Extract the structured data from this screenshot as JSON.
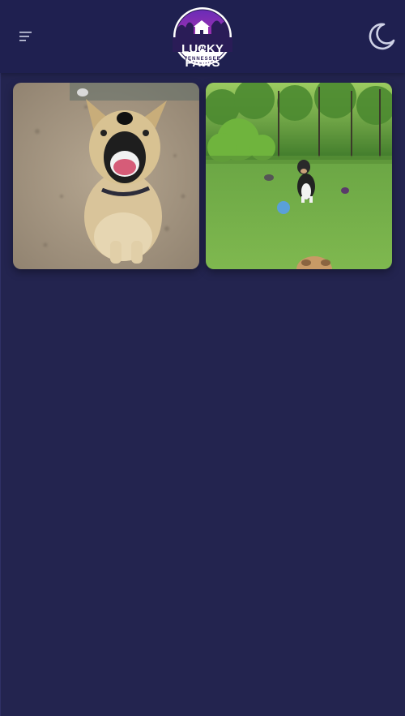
{
  "header": {
    "logo": {
      "title": "LUCKY PAWS",
      "subtitle": "TENNESSEE"
    },
    "menu_icon": "hamburger-menu-icon",
    "theme_icon": "moon-icon"
  },
  "gallery": {
    "photos": [
      {
        "subject": "smiling-dog-photo"
      },
      {
        "subject": "dog-in-field-photo"
      }
    ]
  },
  "colors": {
    "page_bg": "#23244f",
    "header_bg": "#1f2050",
    "logo_ring": "#ffffff",
    "logo_sky": "#c02fa9",
    "icon": "#cfd2e6"
  }
}
